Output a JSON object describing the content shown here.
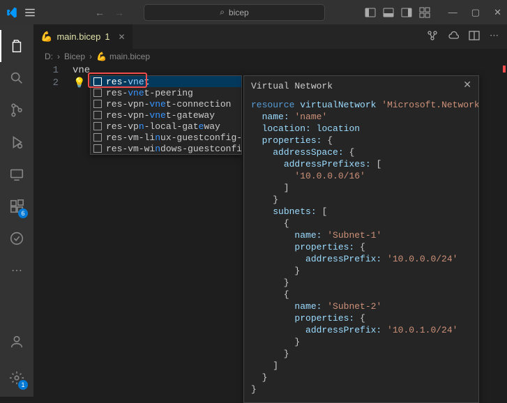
{
  "titlebar": {
    "search_text": "bicep"
  },
  "tabs": [
    {
      "name": "main.bicep",
      "dirty_indicator": "1"
    }
  ],
  "breadcrumbs": [
    "D:",
    "Bicep",
    "main.bicep"
  ],
  "editor": {
    "lines": [
      {
        "num": "1",
        "text": "vne"
      },
      {
        "num": "2",
        "text": ""
      }
    ]
  },
  "autocomplete": {
    "items": [
      {
        "pre": "res-",
        "hl": "vne",
        "post": "t"
      },
      {
        "pre": "res-",
        "hl": "vne",
        "post": "t-peering"
      },
      {
        "pre": "res-vpn-",
        "hl": "vne",
        "post": "t-connection"
      },
      {
        "pre": "res-vpn-",
        "hl": "vne",
        "post": "t-gateway"
      },
      {
        "pre": "res-vp",
        "hl": "n",
        "post": "-local-gat",
        "hl2": "e",
        "post2": "way"
      },
      {
        "pre": "res-vm-li",
        "hl": "n",
        "post": "ux-guestconfig-…"
      },
      {
        "pre": "res-vm-wi",
        "hl": "n",
        "post": "dows-guestconfi…"
      }
    ]
  },
  "details": {
    "title": "Virtual Network",
    "resource_kw": "resource",
    "resource_name": "virtualNetwork",
    "resource_type": "'Microsoft.Network/virtua",
    "props": {
      "name_label": "name:",
      "name_value": "'name'",
      "location_label": "location:",
      "location_value": "location",
      "properties_label": "properties:",
      "addressSpace_label": "addressSpace:",
      "addressPrefixes_label": "addressPrefixes:",
      "addr_prefix_value": "'10.0.0.0/16'",
      "subnets_label": "subnets:",
      "subnet1_name_label": "name:",
      "subnet1_name_value": "'Subnet-1'",
      "subnet1_props_label": "properties:",
      "subnet1_addr_label": "addressPrefix:",
      "subnet1_addr_value": "'10.0.0.0/24'",
      "subnet2_name_label": "name:",
      "subnet2_name_value": "'Subnet-2'",
      "subnet2_props_label": "properties:",
      "subnet2_addr_label": "addressPrefix:",
      "subnet2_addr_value": "'10.0.1.0/24'"
    }
  },
  "badges": {
    "extensions": "6",
    "settings": "1"
  }
}
